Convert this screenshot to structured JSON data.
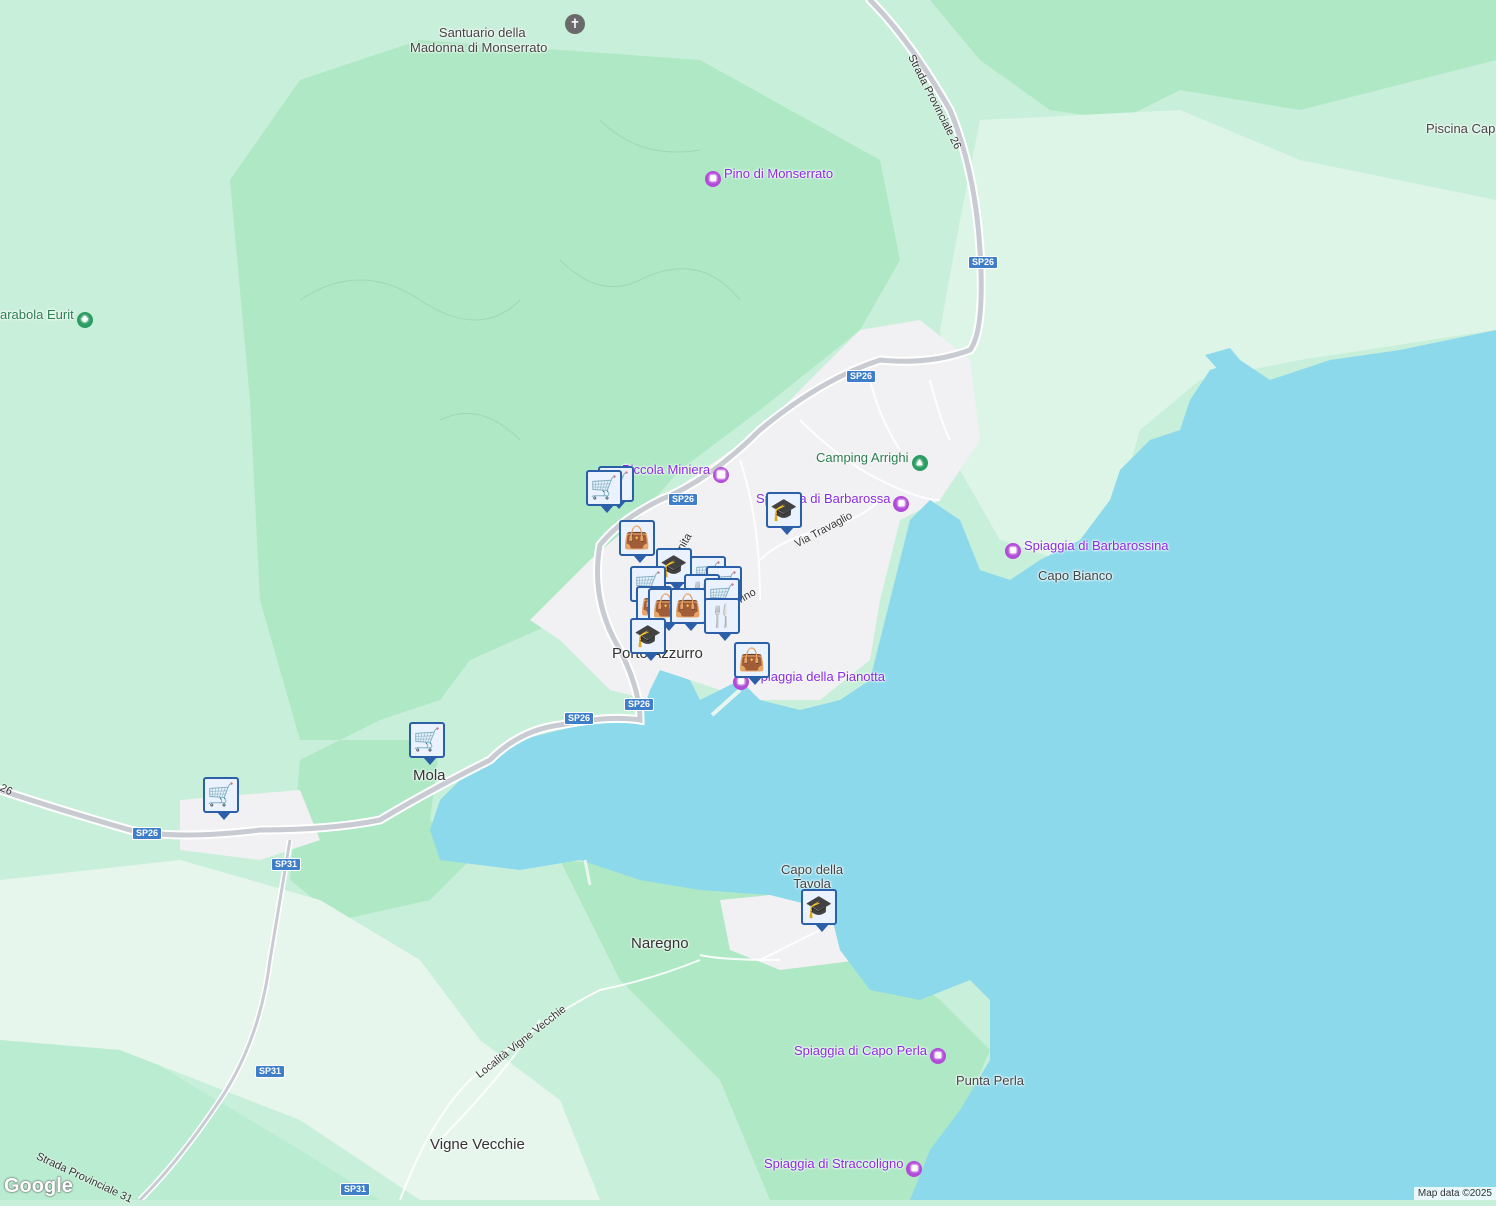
{
  "map": {
    "towns": [
      {
        "id": "porto-azzurro",
        "name": "Porto Azzurro"
      },
      {
        "id": "mola",
        "name": "Mola"
      },
      {
        "id": "naregno",
        "name": "Naregno"
      },
      {
        "id": "vigne-vecchie",
        "name": "Vigne Vecchie"
      }
    ],
    "places": [
      {
        "id": "capo-bianco",
        "name": "Capo Bianco"
      },
      {
        "id": "capo-della-tavola",
        "name": "Capo della\nTavola"
      },
      {
        "id": "punta-perla",
        "name": "Punta Perla"
      },
      {
        "id": "piscina",
        "name": "Piscina Cap"
      }
    ],
    "pois": [
      {
        "id": "santuario",
        "name": "Santuario della\nMadonna di Monserrato",
        "icon": "church-icon"
      },
      {
        "id": "pino",
        "name": "Pino di Monserrato",
        "icon": "camera-icon"
      },
      {
        "id": "piccola-miniera",
        "name": "Piccola Miniera",
        "icon": "museum-icon"
      },
      {
        "id": "camping-arrighi",
        "name": "Camping Arrighi",
        "icon": "tent-icon"
      },
      {
        "id": "spiaggia-barbarossa",
        "name": "Spiaggia di Barbarossa",
        "icon": "camera-icon"
      },
      {
        "id": "spiaggia-barbarossina",
        "name": "Spiaggia di Barbarossina",
        "icon": "camera-icon"
      },
      {
        "id": "spiaggia-pianotta",
        "name": "Spiaggia della Pianotta",
        "icon": "camera-icon"
      },
      {
        "id": "spiaggia-capo-perla",
        "name": "Spiaggia di Capo Perla",
        "icon": "camera-icon"
      },
      {
        "id": "spiaggia-straccoligno",
        "name": "Spiaggia di Straccoligno",
        "icon": "camera-icon"
      },
      {
        "id": "parabola-eurit",
        "name": "arabola Eurit",
        "icon": "tree-icon"
      }
    ],
    "roads": {
      "sp26_label": "SP26",
      "sp31_label": "SP31",
      "strada_provinciale_26": "Strada Provinciale 26",
      "strada_provinciale_31": "Strada Provinciale 31",
      "via_travaglio": "Via Travaglio",
      "localita_vigne_vecchie": "Località Vigne Vecchie",
      "road_26_stub": "26",
      "via_fragment_1": "nita",
      "via_fragment_2": "rino"
    },
    "markers": [
      {
        "type": "cart",
        "icon": "shopping-cart-icon"
      },
      {
        "type": "bag",
        "icon": "shopping-bag-icon"
      },
      {
        "type": "school",
        "icon": "graduation-cap-icon"
      },
      {
        "type": "restaurant",
        "icon": "fork-knife-icon"
      }
    ]
  },
  "attribution": "Map data ©2025",
  "logo": "Google",
  "colors": {
    "sea": "#8dd9ec",
    "forest": "#aee8c5",
    "land": "#c8efd9",
    "urban": "#f1f1f3",
    "poi_purple": "#8a2be2",
    "marker_border": "#2b5fa8"
  }
}
